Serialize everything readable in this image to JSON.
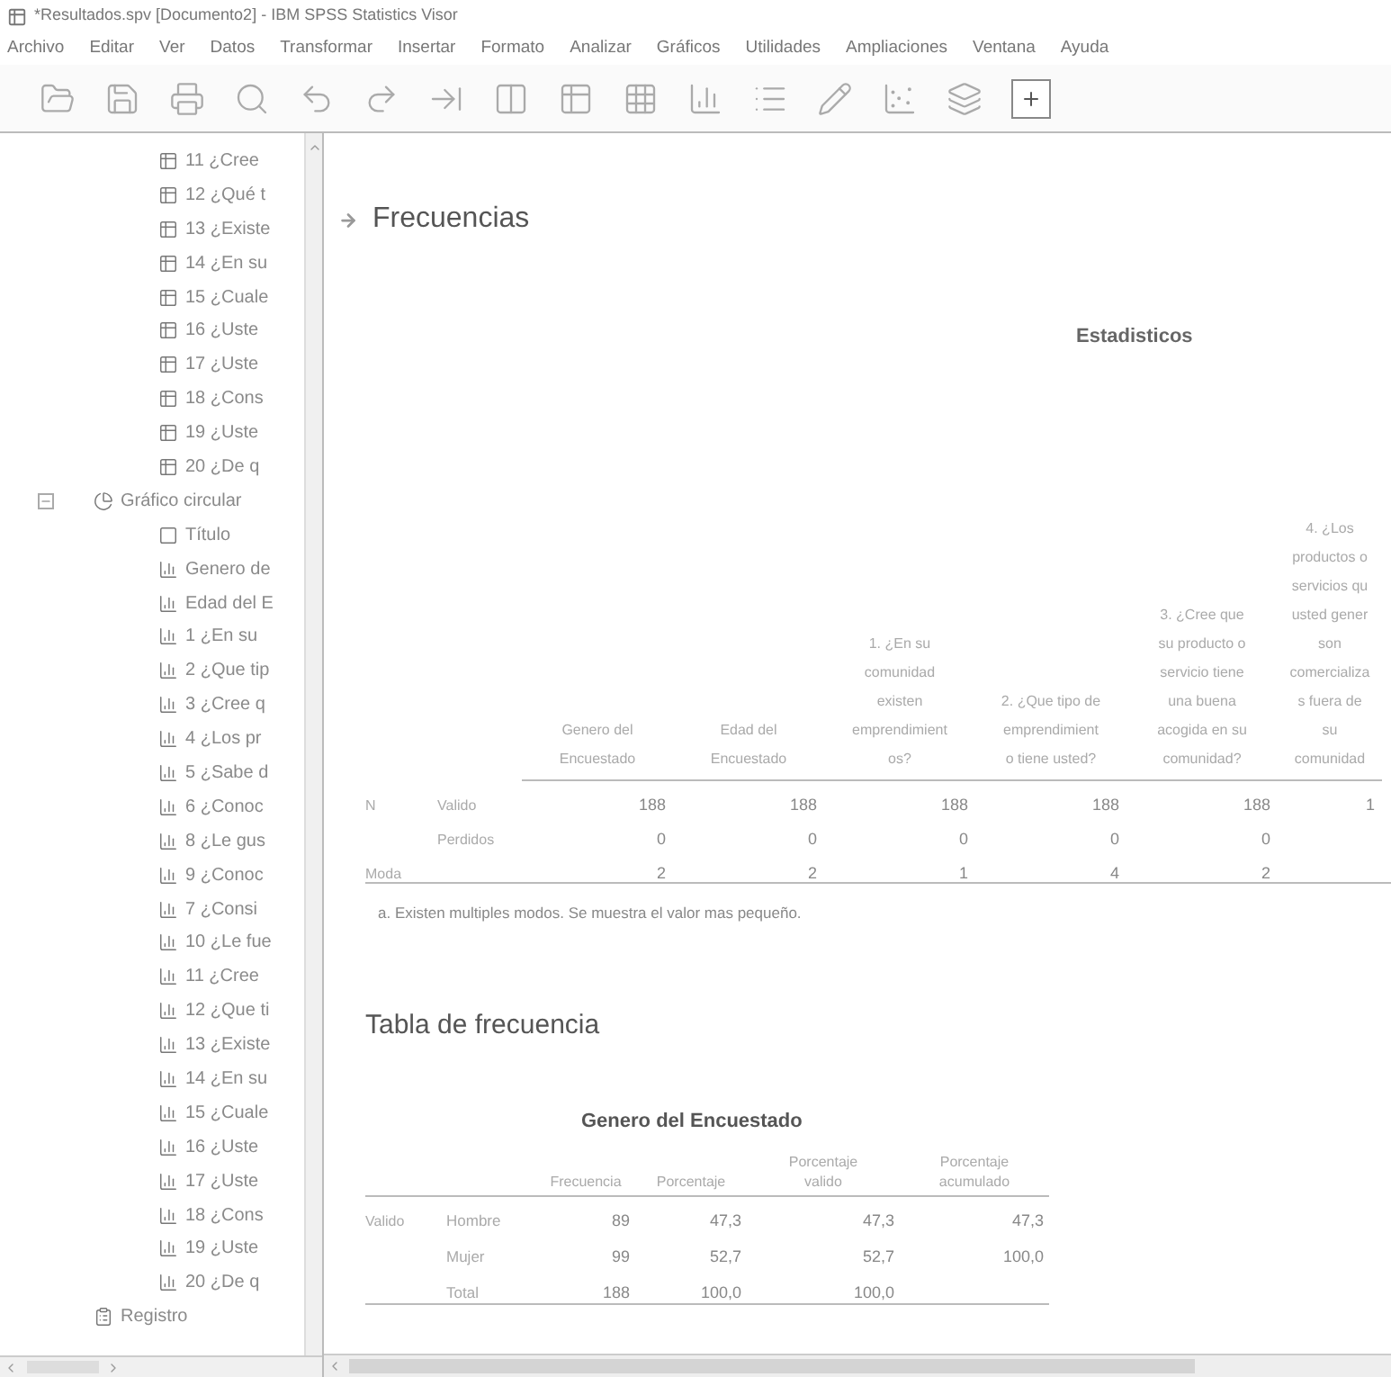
{
  "window": {
    "title": "*Resultados.spv [Documento2] - IBM SPSS Statistics Visor"
  },
  "menu": [
    "Archivo",
    "Editar",
    "Ver",
    "Datos",
    "Transformar",
    "Insertar",
    "Formato",
    "Analizar",
    "Gráficos",
    "Utilidades",
    "Ampliaciones",
    "Ventana",
    "Ayuda"
  ],
  "tree": {
    "continued_items": [
      {
        "label": "11 ¿Cree",
        "kind": "table"
      },
      {
        "label": "12 ¿Qué t",
        "kind": "table"
      },
      {
        "label": "13 ¿Existe",
        "kind": "table"
      },
      {
        "label": "14 ¿En su",
        "kind": "table"
      },
      {
        "label": "15 ¿Cuale",
        "kind": "table"
      },
      {
        "label": "16 ¿Uste",
        "kind": "table"
      },
      {
        "label": "17 ¿Uste",
        "kind": "table"
      },
      {
        "label": "18 ¿Cons",
        "kind": "table"
      },
      {
        "label": "19 ¿Uste",
        "kind": "table"
      },
      {
        "label": "20 ¿De q",
        "kind": "table"
      }
    ],
    "nodes": [
      {
        "label": "Gráfico circular",
        "kind": "chart",
        "expanded": true,
        "children": [
          {
            "label": "Título",
            "kind": "title"
          },
          {
            "label": "Genero de",
            "kind": "variable"
          },
          {
            "label": "Edad del E",
            "kind": "variable"
          },
          {
            "label": "1 ¿En su",
            "kind": "variable"
          },
          {
            "label": "2 ¿Que tip",
            "kind": "variable"
          },
          {
            "label": "3 ¿Cree q",
            "kind": "variable"
          },
          {
            "label": "4 ¿Los pr",
            "kind": "variable"
          },
          {
            "label": "5 ¿Sabe d",
            "kind": "variable"
          },
          {
            "label": "6 ¿Conoc",
            "kind": "variable"
          },
          {
            "label": "8 ¿Le gus",
            "kind": "variable"
          },
          {
            "label": "9 ¿Conoc",
            "kind": "variable"
          },
          {
            "label": "7 ¿Consi",
            "kind": "variable"
          },
          {
            "label": "10 ¿Le fue",
            "kind": "variable"
          },
          {
            "label": "11 ¿Cree",
            "kind": "variable"
          },
          {
            "label": "12 ¿Que ti",
            "kind": "variable"
          },
          {
            "label": "13 ¿Existe",
            "kind": "variable"
          },
          {
            "label": "14 ¿En su",
            "kind": "variable"
          },
          {
            "label": "15 ¿Cuale",
            "kind": "variable"
          },
          {
            "label": "16 ¿Uste",
            "kind": "variable"
          },
          {
            "label": "17 ¿Uste",
            "kind": "variable"
          },
          {
            "label": "18 ¿Cons",
            "kind": "variable"
          },
          {
            "label": "19 ¿Uste",
            "kind": "variable"
          },
          {
            "label": "20 ¿De q",
            "kind": "variable"
          }
        ]
      },
      {
        "label": "Registro",
        "kind": "log"
      }
    ]
  },
  "output": {
    "heading": "Frecuencias",
    "statistics": {
      "title": "Estadisticos",
      "columns": [
        "Genero del\nEncuestado",
        "Edad del\nEncuestado",
        "1. ¿En su\ncomunidad\nexisten\nemprendimient\nos?",
        "2. ¿Que tipo de\nemprendimient\no tiene usted?",
        "3. ¿Cree que\nsu producto o\nservicio tiene\nuna buena\nacogida en su\ncomunidad?",
        "4. ¿Los\nproductos o\nservicios qu\nusted gener\nson\ncomercializa\ns fuera de\nsu\ncomunidad"
      ],
      "rows": [
        {
          "group": "N",
          "label": "Valido",
          "values": [
            "188",
            "188",
            "188",
            "188",
            "188",
            "1"
          ]
        },
        {
          "label": "Perdidos",
          "values": [
            "0",
            "0",
            "0",
            "0",
            "0"
          ]
        },
        {
          "group": "Moda",
          "values": [
            "2",
            "2",
            "1",
            "4",
            "2"
          ]
        }
      ],
      "footnote": "a. Existen multiples modos. Se muestra el valor mas pequeño."
    },
    "section_heading": "Tabla de frecuencia",
    "frequency_table": {
      "title": "Genero del Encuestado",
      "columns": [
        "Frecuencia",
        "Porcentaje",
        "Porcentaje\nvalido",
        "Porcentaje\nacumulado"
      ],
      "rows": [
        {
          "group": "Valido",
          "label": "Hombre",
          "values": [
            "89",
            "47,3",
            "47,3",
            "47,3"
          ]
        },
        {
          "label": "Mujer",
          "values": [
            "99",
            "52,7",
            "52,7",
            "100,0"
          ]
        },
        {
          "label": "Total",
          "values": [
            "188",
            "100,0",
            "100,0"
          ]
        }
      ]
    }
  }
}
